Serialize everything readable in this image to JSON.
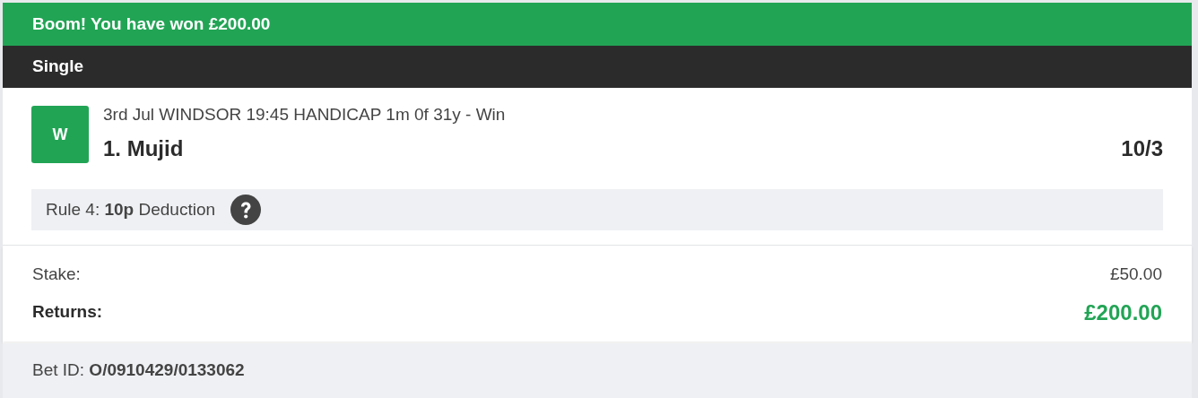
{
  "banner": {
    "text": "Boom! You have won £200.00"
  },
  "bet_type": "Single",
  "selection": {
    "result": "W",
    "event": "3rd Jul WINDSOR 19:45 HANDICAP 1m 0f 31y - Win",
    "runner": "1. Mujid",
    "odds": "10/3",
    "rule4": "Rule 4: **10p** Deduction"
  },
  "stake": {
    "label": "Stake:",
    "value": "£50.00"
  },
  "returns": {
    "label": "Returns:",
    "value": "£200.00"
  },
  "bet_id": "Bet ID: **O/0910429/0133062**"
}
